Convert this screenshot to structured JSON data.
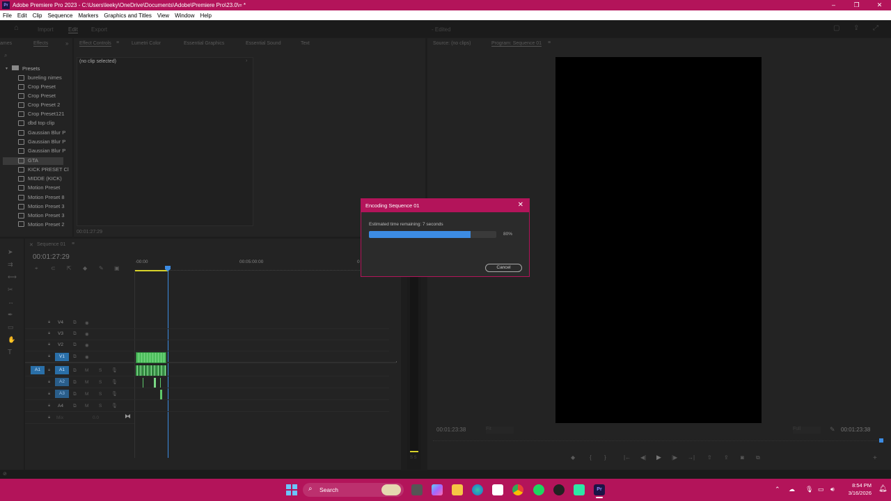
{
  "window": {
    "app_icon_label": "Pr",
    "title": "Adobe Premiere Pro 2023 - C:\\Users\\leeky\\OneDrive\\Documents\\Adobe\\Premiere Pro\\23.0\\= *",
    "minimize": "–",
    "maximize": "❐",
    "close": "✕"
  },
  "menu": [
    "File",
    "Edit",
    "Clip",
    "Sequence",
    "Markers",
    "Graphics and Titles",
    "View",
    "Window",
    "Help"
  ],
  "workspace_tabs": {
    "import": "Import",
    "edit": "Edit",
    "export": "Export",
    "doc_status": "- Edited"
  },
  "effects_panel": {
    "tab_left": "ames",
    "tab_effects": "Effects",
    "root_folder": "Presets",
    "presets": [
      "bureling nimes",
      "Crop Preset",
      "Crop Preset",
      "Crop Preset 2",
      "Crop Preset121",
      "dbd top clip",
      "Gaussian Blur P",
      "Gaussian Blur P",
      "Gaussian Blur P",
      "GTA",
      "KICK PRESET Cl",
      "MIDDE (KICK)",
      "Motion Preset",
      "Motion Preset 8",
      "Motion Preset 3",
      "Motion Preset 3",
      "Motion Preset 2"
    ]
  },
  "effect_controls": {
    "tabs": [
      "Effect Controls",
      "Lumetri Color",
      "Essential Graphics",
      "Essential Sound",
      "Text"
    ],
    "no_clip": "(no clip selected)",
    "timecode": "00:01:27:29"
  },
  "program_monitor": {
    "source_tab": "Source: (no clips)",
    "program_tab": "Program: Sequence 01",
    "timecode_left": "00:01:23:38",
    "fit": "Fit",
    "quality": "Full",
    "timecode_right": "00:01:23:38"
  },
  "timeline": {
    "sequence_tab": "Sequence 01",
    "timecode": "00:01:27:29",
    "ruler": [
      "·00:00",
      "00:05:00:00",
      "0"
    ],
    "video_tracks": [
      "V4",
      "V3",
      "V2",
      "V1"
    ],
    "audio_tracks": [
      "A1",
      "A2",
      "A3",
      "A4"
    ],
    "source_patch": "A1",
    "mix": "Mix",
    "mix_value": "0.0"
  },
  "encoding_dialog": {
    "title": "Encoding Sequence 01",
    "estimate": "Estimated time remaining: 7 seconds",
    "progress": 0.8,
    "percent_label": "80%",
    "cancel": "Cancel"
  },
  "taskbar": {
    "search": "Search",
    "time": "8:54 PM",
    "date": "3/16/2026"
  },
  "colors": {
    "accent": "#b3145a",
    "progress": "#3c8ce3",
    "playhead": "#3c8ce3",
    "clip_green": "#5ec86a"
  }
}
